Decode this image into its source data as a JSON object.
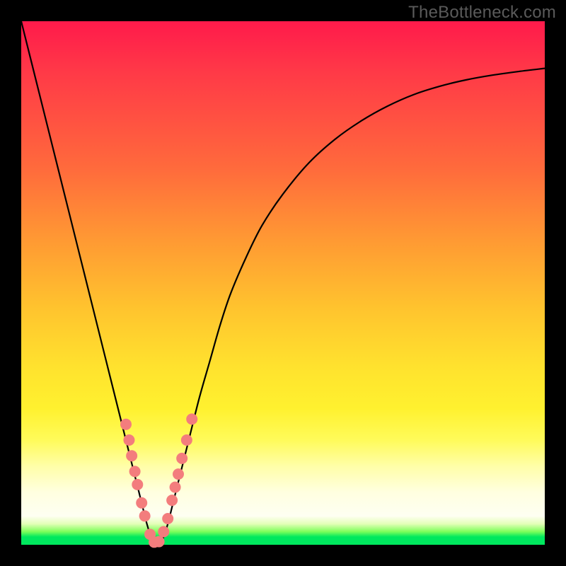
{
  "watermark": "TheBottleneck.com",
  "colors": {
    "frame": "#000000",
    "curve": "#000000",
    "marker_fill": "#f37d7d",
    "marker_stroke": "#f37d7d"
  },
  "chart_data": {
    "type": "line",
    "title": "",
    "xlabel": "",
    "ylabel": "",
    "xlim": [
      0,
      100
    ],
    "ylim": [
      0,
      100
    ],
    "grid": false,
    "legend": false,
    "series": [
      {
        "name": "bottleneck-curve",
        "x": [
          0,
          2,
          4,
          6,
          8,
          10,
          12,
          14,
          16,
          18,
          20,
          22,
          23,
          24,
          25,
          26,
          27,
          28,
          29,
          30,
          32,
          34,
          36,
          38,
          40,
          43,
          46,
          50,
          55,
          60,
          65,
          70,
          75,
          80,
          85,
          90,
          95,
          100
        ],
        "y": [
          100,
          92,
          84,
          76,
          68,
          60,
          52,
          44,
          36,
          28,
          20,
          12,
          8,
          4,
          1,
          0,
          1,
          4,
          8,
          12,
          20,
          28,
          35,
          42,
          48,
          55,
          61,
          67,
          73,
          77.5,
          81,
          83.8,
          86,
          87.6,
          88.8,
          89.7,
          90.4,
          91
        ]
      }
    ],
    "markers": [
      {
        "x": 20.0,
        "y": 23.0
      },
      {
        "x": 20.6,
        "y": 20.0
      },
      {
        "x": 21.1,
        "y": 17.0
      },
      {
        "x": 21.7,
        "y": 14.0
      },
      {
        "x": 22.2,
        "y": 11.5
      },
      {
        "x": 23.0,
        "y": 8.0
      },
      {
        "x": 23.6,
        "y": 5.5
      },
      {
        "x": 24.6,
        "y": 2.0
      },
      {
        "x": 25.4,
        "y": 0.5
      },
      {
        "x": 26.3,
        "y": 0.6
      },
      {
        "x": 27.2,
        "y": 2.5
      },
      {
        "x": 28.0,
        "y": 5.0
      },
      {
        "x": 28.8,
        "y": 8.5
      },
      {
        "x": 29.4,
        "y": 11.0
      },
      {
        "x": 30.0,
        "y": 13.5
      },
      {
        "x": 30.7,
        "y": 16.5
      },
      {
        "x": 31.6,
        "y": 20.0
      },
      {
        "x": 32.6,
        "y": 24.0
      }
    ],
    "marker_radius_px": 8
  }
}
